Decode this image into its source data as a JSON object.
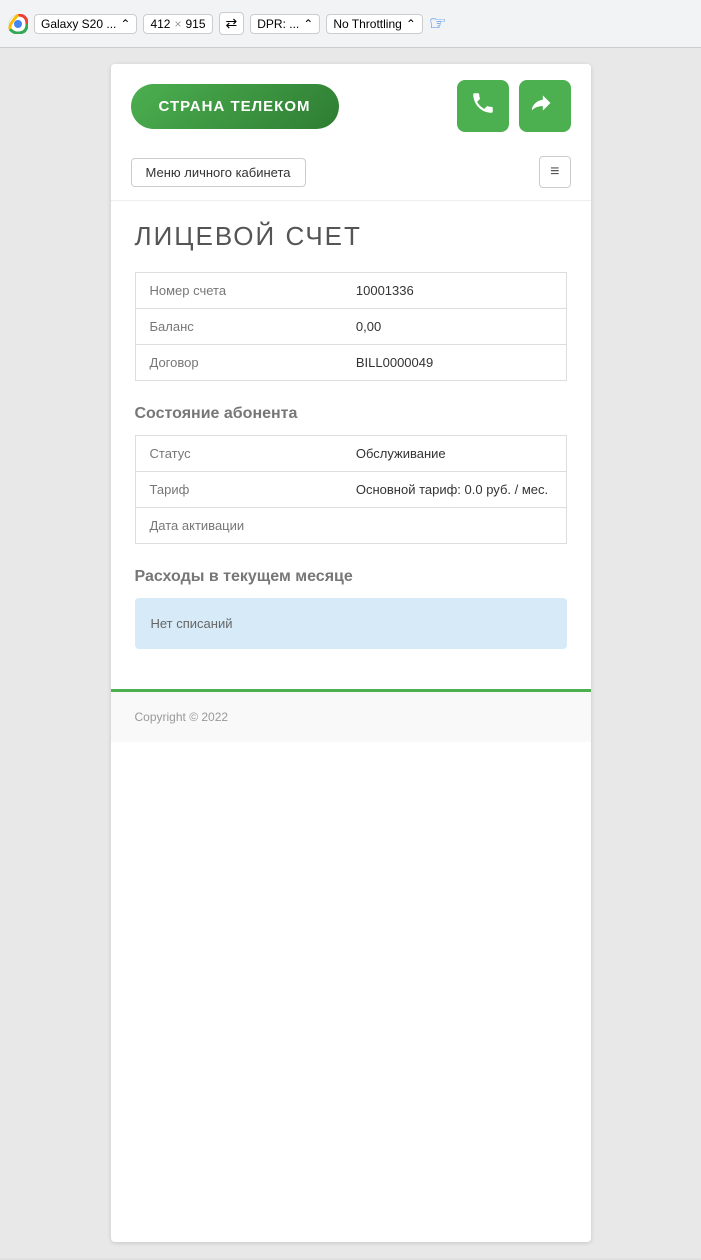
{
  "toolbar": {
    "device_label": "Galaxy S20 ...",
    "width": "412",
    "x_label": "×",
    "height": "915",
    "dpr_label": "DPR: ...",
    "throttle_label": "No Throttling",
    "rotate_icon": "⇄"
  },
  "header": {
    "brand_label": "СТРАНА ТЕЛЕКОМ",
    "phone_icon": "📞",
    "login_icon": "⬛"
  },
  "nav": {
    "menu_label": "Меню личного кабинета",
    "hamburger_icon": "≡"
  },
  "page": {
    "title": "ЛИЦЕВОЙ СЧЕТ"
  },
  "account_table": {
    "rows": [
      {
        "label": "Номер счета",
        "value": "10001336",
        "is_link": false
      },
      {
        "label": "Баланс",
        "value": "0,00",
        "is_link": false
      },
      {
        "label": "Договор",
        "value": "BILL0000049",
        "is_link": true
      }
    ]
  },
  "subscriber_section": {
    "title": "Состояние абонента",
    "rows": [
      {
        "label": "Статус",
        "value": "Обслуживание",
        "is_link": false
      },
      {
        "label": "Тариф",
        "value": "Основной тариф: 0.0 руб. / мес.",
        "is_link": false
      },
      {
        "label": "Дата активации",
        "value": "",
        "is_link": false
      }
    ]
  },
  "expenses_section": {
    "title": "Расходы в текущем месяце",
    "no_items_label": "Нет списаний"
  },
  "footer": {
    "copyright": "Copyright © 2022"
  }
}
